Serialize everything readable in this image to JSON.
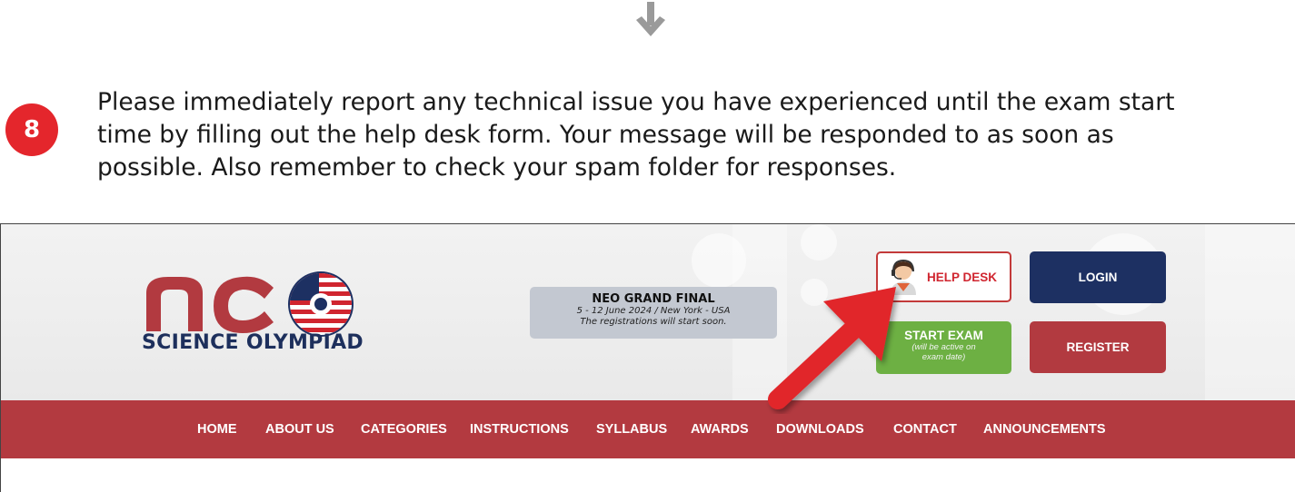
{
  "step": {
    "number": "8",
    "lines": [
      "Please immediately report any technical issue you have experienced until the exam start",
      "time by filling out the help desk form. Your message will be responded to as soon as",
      "possible. Also remember to check your spam folder for responses."
    ]
  },
  "icons": {
    "top": "down-arrow-icon",
    "pointer": "red-pointer-arrow-icon",
    "help": "helpdesk-agent-icon"
  },
  "site": {
    "logo": {
      "subtitle": "SCIENCE OLYMPIAD"
    },
    "announcement": {
      "title": "NEO GRAND FINAL",
      "line1": "5 - 12 June 2024 / New York - USA",
      "line2": "The registrations will start soon."
    },
    "buttons": {
      "help_desk": "HELP DESK",
      "login": "LOGIN",
      "start_exam": "START EXAM",
      "start_exam_note_1": "(will be active on",
      "start_exam_note_2": "exam date)",
      "register": "REGISTER"
    },
    "nav": [
      "HOME",
      "ABOUT US",
      "CATEGORIES",
      "INSTRUCTIONS",
      "SYLLABUS",
      "AWARDS",
      "DOWNLOADS",
      "CONTACT",
      "ANNOUNCEMENTS"
    ]
  },
  "colors": {
    "badge": "#e4262c",
    "nav_bg": "#b33a40",
    "login_bg": "#1d3062",
    "start_bg": "#6db043",
    "register_bg": "#b23a40",
    "pointer_arrow": "#e1262c"
  }
}
